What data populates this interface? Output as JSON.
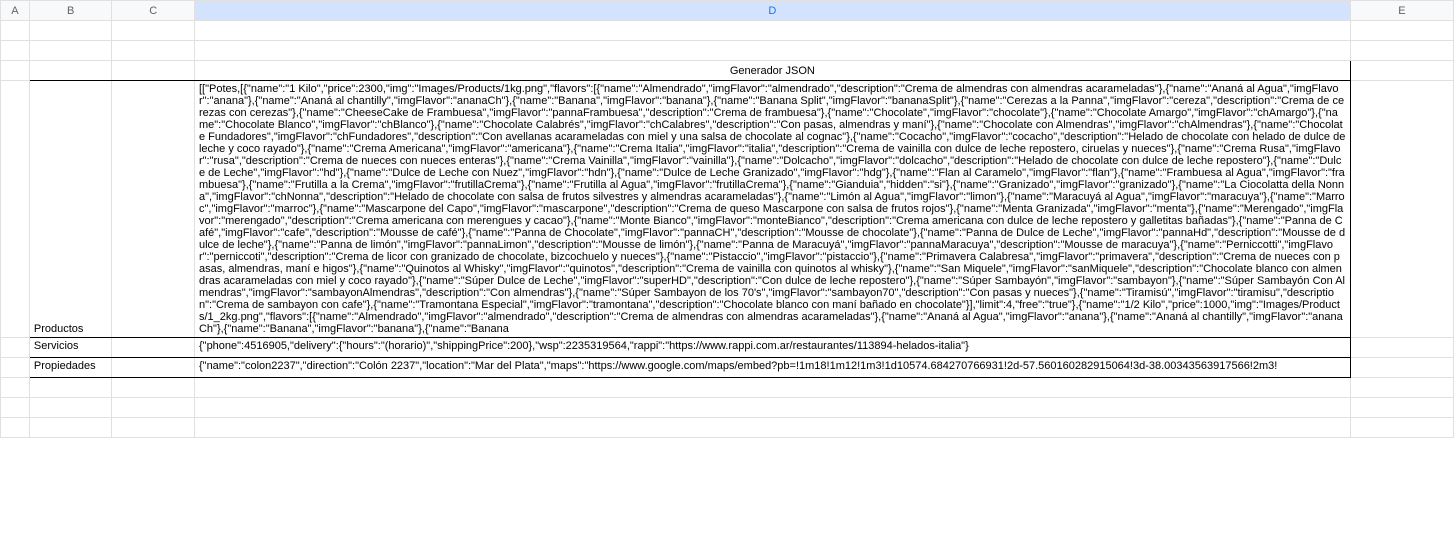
{
  "columns": [
    "A",
    "B",
    "C",
    "D",
    "E"
  ],
  "selected_column": "D",
  "header_title": "Generador JSON",
  "rows": {
    "productos": {
      "label": "Productos",
      "data": "[[\"Potes,[{\"name\":\"1 Kilo\",\"price\":2300,\"img\":\"Images/Products/1kg.png\",\"flavors\":[{\"name\":\"Almendrado\",\"imgFlavor\":\"almendrado\",\"description\":\"Crema de almendras con almendras acarameladas\"},{\"name\":\"Ananá al Agua\",\"imgFlavor\":\"anana\"},{\"name\":\"Ananá al chantilly\",\"imgFlavor\":\"ananaCh\"},{\"name\":\"Banana\",\"imgFlavor\":\"banana\"},{\"name\":\"Banana Split\",\"imgFlavor\":\"bananaSplit\"},{\"name\":\"Cerezas a la Panna\",\"imgFlavor\":\"cereza\",\"description\":\"Crema de cerezas con cerezas\"},{\"name\":\"CheeseCake de Frambuesa\",\"imgFlavor\":\"pannaFrambuesa\",\"description\":\"Crema de frambuesa\"},{\"name\":\"Chocolate\",\"imgFlavor\":\"chocolate\"},{\"name\":\"Chocolate Amargo\",\"imgFlavor\":\"chAmargo\"},{\"name\":\"Chocolate Blanco\",\"imgFlavor\":\"chBlanco\"},{\"name\":\"Chocolate Calabrés\",\"imgFlavor\":\"chCalabres\",\"description\":\"Con pasas, almendras y maní\"},{\"name\":\"Chocolate con Almendras\",\"imgFlavor\":\"chAlmendras\"},{\"name\":\"Chocolate Fundadores\",\"imgFlavor\":\"chFundadores\",\"description\":\"Con avellanas acarameladas con miel y una salsa de chocolate al cognac\"},{\"name\":\"Cocacho\",\"imgFlavor\":\"cocacho\",\"description\":\"Helado de chocolate con helado de dulce de leche y coco rayado\"},{\"name\":\"Crema Americana\",\"imgFlavor\":\"americana\"},{\"name\":\"Crema Italia\",\"imgFlavor\":\"italia\",\"description\":\"Crema de vainilla con dulce de leche repostero, ciruelas y nueces\"},{\"name\":\"Crema Rusa\",\"imgFlavor\":\"rusa\",\"description\":\"Crema de nueces con nueces enteras\"},{\"name\":\"Crema Vainilla\",\"imgFlavor\":\"vainilla\"},{\"name\":\"Dolcacho\",\"imgFlavor\":\"dolcacho\",\"description\":\"Helado de chocolate con dulce de leche repostero\"},{\"name\":\"Dulce de Leche\",\"imgFlavor\":\"hd\"},{\"name\":\"Dulce de Leche con Nuez\",\"imgFlavor\":\"hdn\"},{\"name\":\"Dulce de Leche Granizado\",\"imgFlavor\":\"hdg\"},{\"name\":\"Flan al Caramelo\",\"imgFlavor\":\"flan\"},{\"name\":\"Frambuesa al Agua\",\"imgFlavor\":\"frambuesa\"},{\"name\":\"Frutilla a la Crema\",\"imgFlavor\":\"frutillaCrema\"},{\"name\":\"Frutilla al Agua\",\"imgFlavor\":\"frutillaCrema\"},{\"name\":\"Gianduia\",\"hidden\":\"si\"},{\"name\":\"Granizado\",\"imgFlavor\":\"granizado\"},{\"name\":\"La Ciocolatta della Nonna\",\"imgFlavor\":\"chNonna\",\"description\":\"Helado de chocolate con salsa de frutos silvestres y almendras acarameladas\"},{\"name\":\"Limón al Agua\",\"imgFlavor\":\"limon\"},{\"name\":\"Maracuyá al Agua\",\"imgFlavor\":\"maracuya\"},{\"name\":\"Marroc\",\"imgFlavor\":\"marroc\"},{\"name\":\"Mascarpone del Capo\",\"imgFlavor\":\"mascarpone\",\"description\":\"Crema de queso Mascarpone con salsa de frutos rojos\"},{\"name\":\"Menta Granizada\",\"imgFlavor\":\"menta\"},{\"name\":\"Merengado\",\"imgFlavor\":\"merengado\",\"description\":\"Crema americana con merengues y cacao\"},{\"name\":\"Monte Bianco\",\"imgFlavor\":\"monteBianco\",\"description\":\"Crema americana con dulce de leche repostero y galletitas bañadas\"},{\"name\":\"Panna de Café\",\"imgFlavor\":\"cafe\",\"description\":\"Mousse de café\"},{\"name\":\"Panna de Chocolate\",\"imgFlavor\":\"pannaCH\",\"description\":\"Mousse de chocolate\"},{\"name\":\"Panna de Dulce de Leche\",\"imgFlavor\":\"pannaHd\",\"description\":\"Mousse de dulce de leche\"},{\"name\":\"Panna de limón\",\"imgFlavor\":\"pannaLimon\",\"description\":\"Mousse de limón\"},{\"name\":\"Panna de Maracuyá\",\"imgFlavor\":\"pannaMaracuya\",\"description\":\"Mousse de maracuya\"},{\"name\":\"Perniccotti\",\"imgFlavor\":\"perniccoti\",\"description\":\"Crema de licor con granizado de chocolate, bizcochuelo y nueces\"},{\"name\":\"Pistaccio\",\"imgFlavor\":\"pistaccio\"},{\"name\":\"Primavera Calabresa\",\"imgFlavor\":\"primavera\",\"description\":\"Crema de nueces con pasas, almendras, maní e higos\"},{\"name\":\"Quinotos al Whisky\",\"imgFlavor\":\"quinotos\",\"description\":\"Crema de vainilla con quinotos al whisky\"},{\"name\":\"San Miquele\",\"imgFlavor\":\"sanMiquele\",\"description\":\"Chocolate blanco con almendras acarameladas con miel y coco rayado\"},{\"name\":\"Súper Dulce de Leche\",\"imgFlavor\":\"superHD\",\"description\":\"Con dulce de leche repostero\"},{\"name\":\"Súper Sambayón\",\"imgFlavor\":\"sambayon\"},{\"name\":\"Súper Sambayón Con Almendras\",\"imgFlavor\":\"sambayonAlmendras\",\"description\":\"Con almendras\"},{\"name\":\"Súper Sambayon de los 70's\",\"imgFlavor\":\"sambayon70\",\"description\":\"Con pasas y nueces\"},{\"name\":\"Tiramisú\",\"imgFlavor\":\"tiramisu\",\"description\":\"Crema de sambayon con cafe\"},{\"name\":\"Tramontana Especial\",\"imgFlavor\":\"tramontana\",\"description\":\"Chocolate blanco con maní bañado en chocolate\"}],\"limit\":4,\"free\":\"true\"},{\"name\":\"1/2 Kilo\",\"price\":1000,\"img\":\"Images/Products/1_2kg.png\",\"flavors\":[{\"name\":\"Almendrado\",\"imgFlavor\":\"almendrado\",\"description\":\"Crema de almendras con almendras acarameladas\"},{\"name\":\"Ananá al Agua\",\"imgFlavor\":\"anana\"},{\"name\":\"Ananá al chantilly\",\"imgFlavor\":\"ananaCh\"},{\"name\":\"Banana\",\"imgFlavor\":\"banana\"},{\"name\":\"Banana"
    },
    "servicios": {
      "label": "Servicios",
      "data": "{\"phone\":4516905,\"delivery\":{\"hours\":\"(horario)\",\"shippingPrice\":200},\"wsp\":2235319564,\"rappi\":\"https://www.rappi.com.ar/restaurantes/113894-helados-italia\"}"
    },
    "propiedades": {
      "label": "Propiedades",
      "data": "{\"name\":\"colon2237\",\"direction\":\"Colón 2237\",\"location\":\"Mar del Plata\",\"maps\":\"https://www.google.com/maps/embed?pb=!1m18!1m12!1m3!1d10574.684270766931!2d-57.560160282915064!3d-38.00343563917566!2m3!"
    }
  }
}
